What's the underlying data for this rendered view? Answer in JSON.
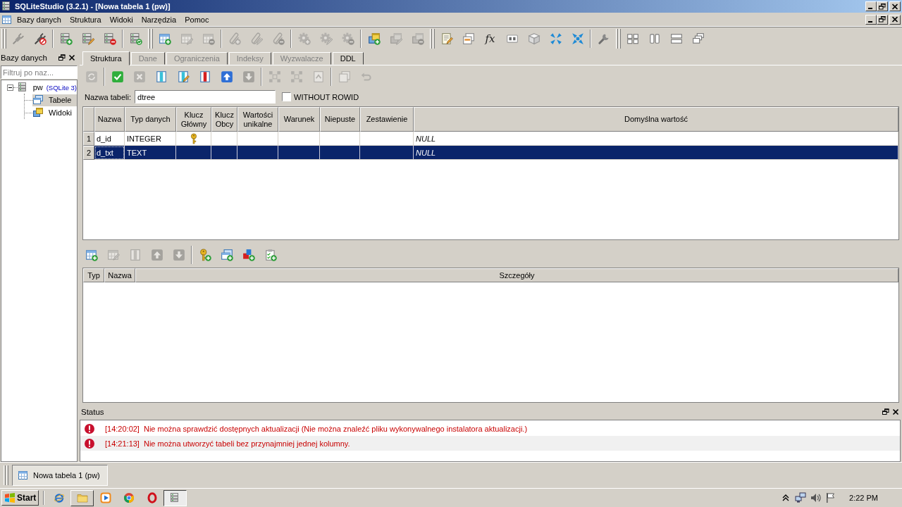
{
  "window": {
    "title": "SQLiteStudio (3.2.1) - [Nowa tabela 1 (pw)]"
  },
  "menu": [
    {
      "label": "Bazy danych"
    },
    {
      "label": "Struktura"
    },
    {
      "label": "Widoki"
    },
    {
      "label": "Narzędzia"
    },
    {
      "label": "Pomoc"
    }
  ],
  "toolbar": {
    "groups": [
      {
        "buttons": [
          {
            "disabled": true
          },
          {
            "disabled": false
          }
        ]
      },
      {
        "buttons": [
          {
            "disabled": false
          },
          {
            "disabled": false
          },
          {
            "disabled": false
          }
        ]
      },
      {
        "buttons": [
          {
            "disabled": false
          }
        ]
      },
      {
        "buttons": [
          {
            "disabled": false
          },
          {
            "disabled": true
          },
          {
            "disabled": true
          }
        ]
      },
      {
        "buttons": [
          {
            "disabled": true
          },
          {
            "disabled": true
          },
          {
            "disabled": true
          }
        ]
      },
      {
        "buttons": [
          {
            "disabled": true
          },
          {
            "disabled": true
          },
          {
            "disabled": true
          }
        ]
      },
      {
        "buttons": [
          {
            "disabled": false
          },
          {
            "disabled": true
          },
          {
            "disabled": true
          }
        ]
      },
      {
        "buttons": [
          {
            "disabled": false
          },
          {
            "disabled": false
          },
          {
            "disabled": false,
            "glyph": "fx"
          },
          {
            "disabled": false
          },
          {
            "disabled": false
          },
          {
            "disabled": false
          },
          {
            "disabled": false
          }
        ]
      },
      {
        "buttons": [
          {
            "disabled": false
          }
        ]
      },
      {
        "buttons": [
          {
            "disabled": false
          },
          {
            "disabled": false
          },
          {
            "disabled": false
          },
          {
            "disabled": false
          }
        ]
      }
    ]
  },
  "databases_panel": {
    "title": "Bazy danych",
    "filter": {
      "placeholder": "Filtruj po naz..."
    },
    "tree": [
      {
        "label": "pw",
        "tag": "(SQLite 3)",
        "expanded": true,
        "selected": false,
        "children": [
          {
            "label": "Tabele",
            "selected": true
          },
          {
            "label": "Widoki",
            "selected": false
          }
        ]
      }
    ]
  },
  "editor": {
    "tabs": [
      {
        "label": "Struktura",
        "selected": true,
        "disabled": false
      },
      {
        "label": "Dane",
        "selected": false,
        "disabled": true
      },
      {
        "label": "Ograniczenia",
        "selected": false,
        "disabled": true
      },
      {
        "label": "Indeksy",
        "selected": false,
        "disabled": true
      },
      {
        "label": "Wyzwalacze",
        "selected": false,
        "disabled": true
      },
      {
        "label": "DDL",
        "selected": false,
        "disabled": false
      }
    ],
    "toolbar": {
      "groups": [
        {
          "buttons": [
            {
              "disabled": true
            }
          ]
        },
        {
          "buttons": [
            {
              "disabled": false
            },
            {
              "disabled": true
            },
            {
              "disabled": false
            },
            {
              "disabled": false
            },
            {
              "disabled": false
            },
            {
              "disabled": false
            },
            {
              "disabled": true
            }
          ]
        },
        {
          "buttons": [
            {
              "disabled": true
            },
            {
              "disabled": true
            },
            {
              "disabled": true
            }
          ]
        },
        {
          "buttons": [
            {
              "disabled": true
            },
            {
              "disabled": true
            }
          ]
        }
      ]
    },
    "table_name": {
      "label": "Nazwa tabeli:",
      "value": "dtree"
    },
    "without_rowid": {
      "label": "WITHOUT ROWID",
      "checked": false
    },
    "columns_table": {
      "columns": [
        "Nazwa",
        "Typ danych",
        "Klucz Główny",
        "Klucz Obcy",
        "Wartości unikalne",
        "Warunek",
        "Niepuste",
        "Zestawienie",
        "Domyślna wartość"
      ],
      "rows": [
        {
          "number": "1",
          "name": "d_id",
          "type": "INTEGER",
          "primary_key": true,
          "default": "NULL",
          "selected": false
        },
        {
          "number": "2",
          "name": "d_txt",
          "type": "TEXT",
          "primary_key": false,
          "default": "NULL",
          "selected": true
        }
      ]
    },
    "constraints_toolbar": {
      "groups": [
        {
          "buttons": [
            {
              "disabled": false
            },
            {
              "disabled": true
            },
            {
              "disabled": true
            },
            {
              "disabled": true
            },
            {
              "disabled": true
            }
          ]
        },
        {
          "buttons": [
            {
              "disabled": false
            },
            {
              "disabled": false
            },
            {
              "disabled": false
            },
            {
              "disabled": false
            }
          ]
        }
      ]
    },
    "constraints_table": {
      "columns": [
        "Typ",
        "Nazwa",
        "Szczegóły"
      ]
    }
  },
  "status": {
    "title": "Status",
    "messages": [
      {
        "kind": "error",
        "time": "[14:20:02]",
        "text": "Nie można sprawdzić dostępnych aktualizacji (Nie można znaleźć pliku wykonywalnego instalatora aktualizacji.)"
      },
      {
        "kind": "error",
        "time": "[14:21:13]",
        "text": "Nie można utworzyć tabeli bez przynajmniej jednej kolumny."
      }
    ]
  },
  "open_windows": [
    {
      "label": "Nowa tabela 1 (pw)",
      "selected": true
    }
  ],
  "taskbar": {
    "start": "Start",
    "apps": [
      {
        "running": false,
        "selected": false
      },
      {
        "running": true,
        "selected": false
      },
      {
        "running": false,
        "selected": false
      },
      {
        "running": false,
        "selected": false
      },
      {
        "running": false,
        "selected": false
      },
      {
        "running": true,
        "selected": true
      }
    ],
    "clock": "2:22 PM"
  }
}
